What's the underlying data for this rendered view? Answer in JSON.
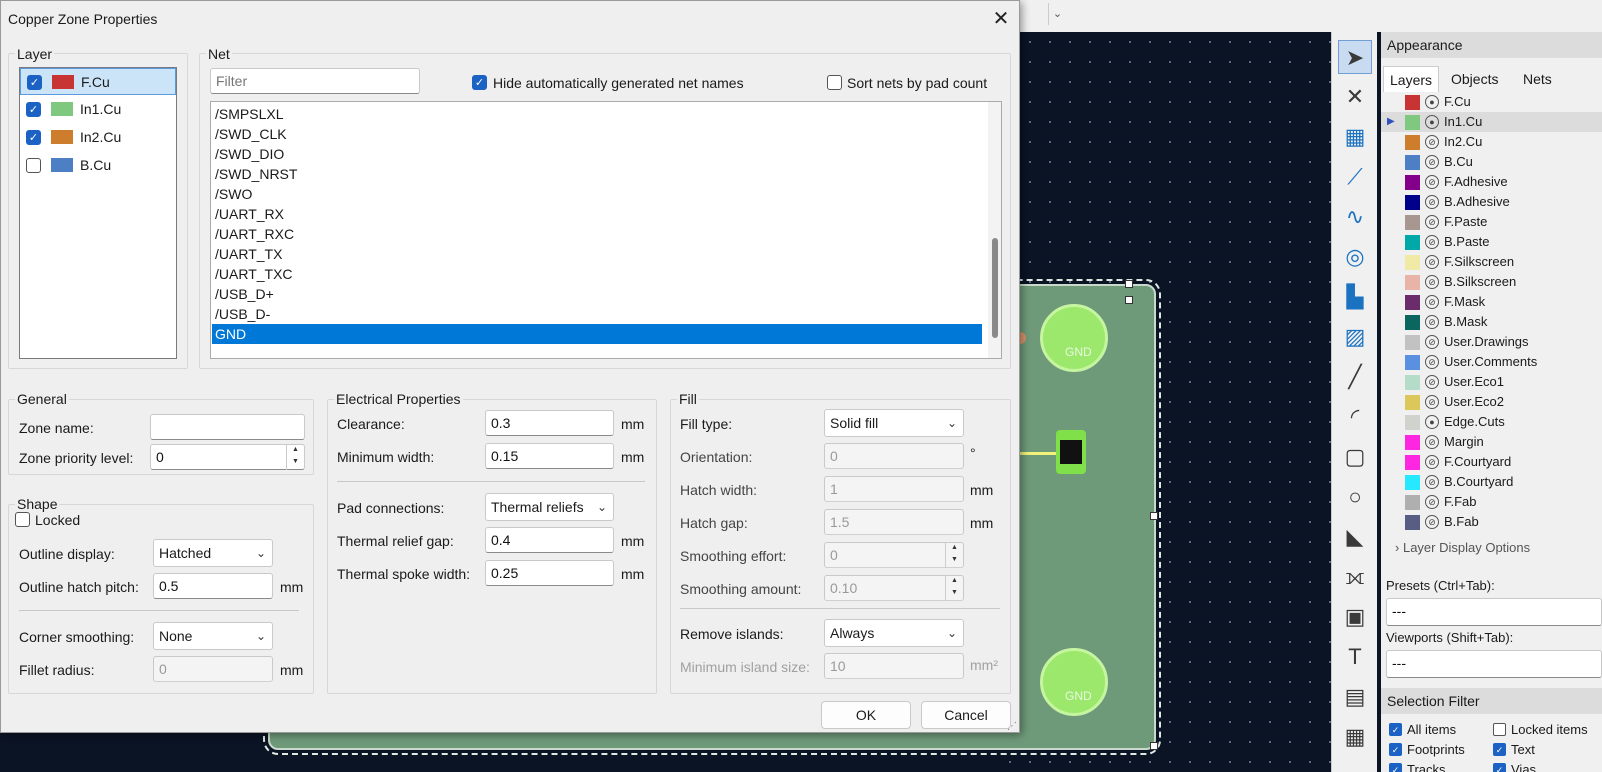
{
  "dialog": {
    "title": "Copper Zone Properties",
    "close_icon": "close-icon",
    "ok_label": "OK",
    "cancel_label": "Cancel"
  },
  "layer_group": {
    "label": "Layer",
    "items": [
      {
        "name": "F.Cu",
        "checked": true,
        "color": "#c83434",
        "selected": true
      },
      {
        "name": "In1.Cu",
        "checked": true,
        "color": "#7fc87f",
        "selected": false
      },
      {
        "name": "In2.Cu",
        "checked": true,
        "color": "#ce7d2c",
        "selected": false
      },
      {
        "name": "B.Cu",
        "checked": false,
        "color": "#4d7fc4",
        "selected": false
      }
    ]
  },
  "net_group": {
    "label": "Net",
    "filter_placeholder": "Filter",
    "hide_auto_label": "Hide automatically generated net names",
    "hide_auto_checked": true,
    "sort_label": "Sort nets by pad count",
    "sort_checked": false,
    "nets": [
      "/SMPSLXL",
      "/SWD_CLK",
      "/SWD_DIO",
      "/SWD_NRST",
      "/SWO",
      "/UART_RX",
      "/UART_RXC",
      "/UART_TX",
      "/UART_TXC",
      "/USB_D+",
      "/USB_D-",
      "GND"
    ],
    "selected_net": "GND"
  },
  "general": {
    "label": "General",
    "zone_name_label": "Zone name:",
    "zone_name_value": "",
    "priority_label": "Zone priority level:",
    "priority_value": "0"
  },
  "shape": {
    "label": "Shape",
    "locked_label": "Locked",
    "locked_checked": false,
    "outline_display_label": "Outline display:",
    "outline_display_value": "Hatched",
    "hatch_pitch_label": "Outline hatch pitch:",
    "hatch_pitch_value": "0.5",
    "hatch_pitch_unit": "mm",
    "corner_smoothing_label": "Corner smoothing:",
    "corner_smoothing_value": "None",
    "fillet_radius_label": "Fillet radius:",
    "fillet_radius_value": "0",
    "fillet_radius_unit": "mm"
  },
  "electrical": {
    "label": "Electrical Properties",
    "clearance_label": "Clearance:",
    "clearance_value": "0.3",
    "clearance_unit": "mm",
    "min_width_label": "Minimum width:",
    "min_width_value": "0.15",
    "min_width_unit": "mm",
    "pad_conn_label": "Pad connections:",
    "pad_conn_value": "Thermal reliefs",
    "relief_gap_label": "Thermal relief gap:",
    "relief_gap_value": "0.4",
    "relief_gap_unit": "mm",
    "spoke_width_label": "Thermal spoke width:",
    "spoke_width_value": "0.25",
    "spoke_width_unit": "mm"
  },
  "fill": {
    "label": "Fill",
    "fill_type_label": "Fill type:",
    "fill_type_value": "Solid fill",
    "orientation_label": "Orientation:",
    "orientation_value": "0",
    "orientation_unit": "°",
    "hatch_width_label": "Hatch width:",
    "hatch_width_value": "1",
    "hatch_width_unit": "mm",
    "hatch_gap_label": "Hatch gap:",
    "hatch_gap_value": "1.5",
    "hatch_gap_unit": "mm",
    "smooth_effort_label": "Smoothing effort:",
    "smooth_effort_value": "0",
    "smooth_amount_label": "Smoothing amount:",
    "smooth_amount_value": "0.10",
    "remove_islands_label": "Remove islands:",
    "remove_islands_value": "Always",
    "min_island_label": "Minimum island size:",
    "min_island_value": "10",
    "min_island_unit": "mm²"
  },
  "appearance": {
    "title": "Appearance",
    "tabs": [
      "Layers",
      "Objects",
      "Nets"
    ],
    "layers": [
      {
        "name": "F.Cu",
        "color": "#c83434",
        "visible": true
      },
      {
        "name": "In1.Cu",
        "color": "#7fc87f",
        "visible": true,
        "active": true
      },
      {
        "name": "In2.Cu",
        "color": "#ce7d2c",
        "visible": false
      },
      {
        "name": "B.Cu",
        "color": "#4d7fc4",
        "visible": false
      },
      {
        "name": "F.Adhesive",
        "color": "#84008a",
        "visible": false
      },
      {
        "name": "B.Adhesive",
        "color": "#00008a",
        "visible": false
      },
      {
        "name": "F.Paste",
        "color": "#a89690",
        "visible": false
      },
      {
        "name": "B.Paste",
        "color": "#00a8a8",
        "visible": false
      },
      {
        "name": "F.Silkscreen",
        "color": "#f0eaa6",
        "visible": false
      },
      {
        "name": "B.Silkscreen",
        "color": "#e8b4a8",
        "visible": false
      },
      {
        "name": "F.Mask",
        "color": "#6a2c6a",
        "visible": false
      },
      {
        "name": "B.Mask",
        "color": "#0b6660",
        "visible": false
      },
      {
        "name": "User.Drawings",
        "color": "#c2c2c2",
        "visible": false
      },
      {
        "name": "User.Comments",
        "color": "#5990e0",
        "visible": false
      },
      {
        "name": "User.Eco1",
        "color": "#b4dcc8",
        "visible": false
      },
      {
        "name": "User.Eco2",
        "color": "#dcc85a",
        "visible": false
      },
      {
        "name": "Edge.Cuts",
        "color": "#d0d2cd",
        "visible": true
      },
      {
        "name": "Margin",
        "color": "#ff26e2",
        "visible": false
      },
      {
        "name": "F.Courtyard",
        "color": "#ff26e2",
        "visible": false
      },
      {
        "name": "B.Courtyard",
        "color": "#26e9ff",
        "visible": false
      },
      {
        "name": "F.Fab",
        "color": "#afafaf",
        "visible": false
      },
      {
        "name": "B.Fab",
        "color": "#585d84",
        "visible": false
      }
    ],
    "display_options_label": "Layer Display Options",
    "presets_label": "Presets (Ctrl+Tab):",
    "presets_value": "---",
    "viewports_label": "Viewports (Shift+Tab):",
    "viewports_value": "---"
  },
  "selection_filter": {
    "title": "Selection Filter",
    "items": [
      {
        "label": "All items",
        "checked": true
      },
      {
        "label": "Locked items",
        "checked": false
      },
      {
        "label": "Footprints",
        "checked": true
      },
      {
        "label": "Text",
        "checked": true
      },
      {
        "label": "Tracks",
        "checked": true
      },
      {
        "label": "Vias",
        "checked": true
      }
    ]
  },
  "board": {
    "pad_label": "GND"
  },
  "toolbar_icons": [
    "select-arrow-icon",
    "local-ratsnest-icon",
    "footprint-icon",
    "route-track-icon",
    "tune-length-icon",
    "via-icon",
    "add-zone-icon",
    "rule-area-icon",
    "line-icon",
    "arc-icon",
    "rectangle-icon",
    "circle-icon",
    "polygon-icon",
    "dimension-icon",
    "image-icon",
    "text-icon",
    "textbox-icon",
    "table-icon"
  ],
  "colors": {
    "accent": "#0078d7",
    "board": "#6f9a7a",
    "canvas": "#0b1425"
  }
}
